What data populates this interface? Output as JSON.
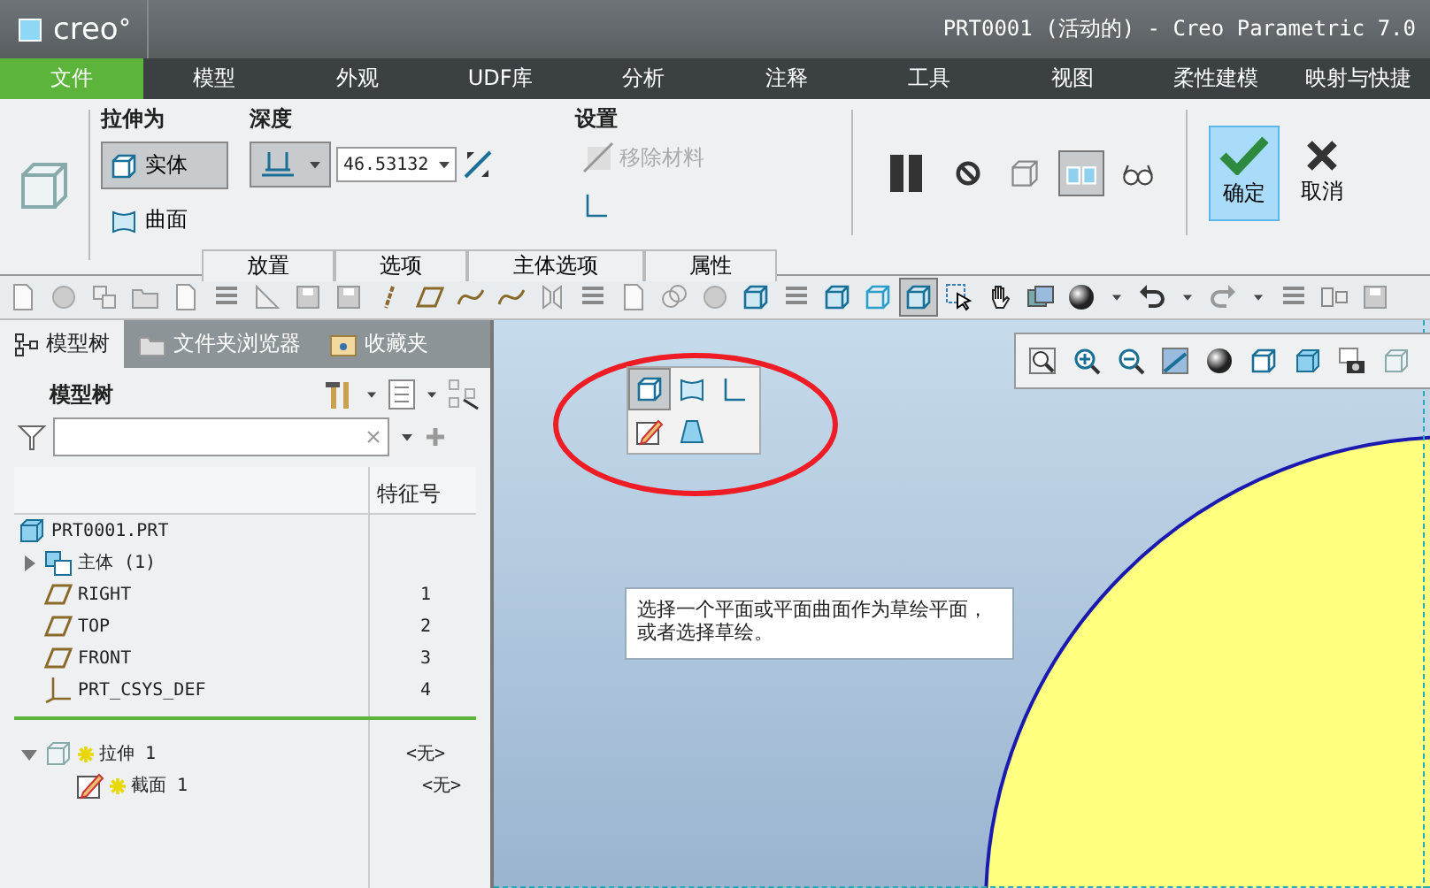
{
  "title_bar": {
    "app_name": "creo",
    "title": "PRT0001 (活动的) - Creo Parametric 7.0"
  },
  "menu_tabs": [
    {
      "label": "文件",
      "selected": true
    },
    {
      "label": "模型",
      "selected": false
    },
    {
      "label": "外观",
      "selected": false
    },
    {
      "label": "UDF库",
      "selected": false
    },
    {
      "label": "分析",
      "selected": false
    },
    {
      "label": "注释",
      "selected": false
    },
    {
      "label": "工具",
      "selected": false
    },
    {
      "label": "视图",
      "selected": false
    },
    {
      "label": "柔性建模",
      "selected": false
    },
    {
      "label": "映射与快捷",
      "selected": false
    }
  ],
  "ribbon": {
    "extrude_as": {
      "title": "拉伸为",
      "options": [
        {
          "label": "实体",
          "kind": "solid",
          "selected": true
        },
        {
          "label": "曲面",
          "kind": "surface",
          "selected": false
        }
      ]
    },
    "depth": {
      "title": "深度",
      "value": "46.53132"
    },
    "settings": {
      "title": "设置",
      "remove_material": {
        "label": "移除材料",
        "disabled": true
      }
    },
    "panel_tabs": [
      "放置",
      "选项",
      "主体选项",
      "属性"
    ],
    "preview_tools": [
      {
        "kind": "pause",
        "selected": false
      },
      {
        "kind": "no_entry",
        "selected": false
      },
      {
        "kind": "wire_preview",
        "selected": false
      },
      {
        "kind": "verify",
        "selected": true
      },
      {
        "kind": "glasses",
        "selected": false
      }
    ],
    "ok": {
      "label": "确定",
      "selected": true
    },
    "cancel": {
      "label": "取消"
    }
  },
  "toolbar": [
    {
      "kind": "document",
      "selected": false
    },
    {
      "kind": "sphere",
      "selected": false
    },
    {
      "kind": "copy",
      "selected": false
    },
    {
      "kind": "folder",
      "selected": false
    },
    {
      "kind": "document",
      "selected": false
    },
    {
      "kind": "list",
      "selected": false
    },
    {
      "kind": "ruler",
      "selected": false
    },
    {
      "kind": "disk",
      "selected": false
    },
    {
      "kind": "disk",
      "selected": false
    },
    {
      "kind": "line",
      "selected": false
    },
    {
      "kind": "plane",
      "selected": false
    },
    {
      "kind": "curve",
      "selected": false
    },
    {
      "kind": "curve",
      "selected": false
    },
    {
      "kind": "mirror",
      "selected": false
    },
    {
      "kind": "list",
      "selected": false
    },
    {
      "kind": "document",
      "selected": false
    },
    {
      "kind": "circles",
      "selected": false
    },
    {
      "kind": "sphere",
      "selected": false
    },
    {
      "kind": "cube",
      "selected": false
    },
    {
      "kind": "list",
      "selected": false
    },
    {
      "kind": "cube",
      "selected": false
    },
    {
      "kind": "wire_cube",
      "selected": false
    },
    {
      "kind": "cube",
      "selected": true
    },
    {
      "kind": "cursor",
      "selected": false
    },
    {
      "kind": "hand",
      "selected": false
    },
    {
      "kind": "images",
      "selected": false
    },
    {
      "kind": "ball",
      "selected": false
    },
    {
      "kind": "caret",
      "selected": false
    },
    {
      "kind": "undo",
      "selected": false
    },
    {
      "kind": "caret",
      "selected": false
    },
    {
      "kind": "redo",
      "selected": false
    },
    {
      "kind": "caret",
      "selected": false
    },
    {
      "kind": "list",
      "selected": false
    },
    {
      "kind": "layout",
      "selected": false
    },
    {
      "kind": "disk",
      "selected": false
    }
  ],
  "navigator": {
    "tabs": [
      {
        "label": "模型树",
        "kind": "tree",
        "selected": true
      },
      {
        "label": "文件夹浏览器",
        "kind": "folders",
        "selected": false
      },
      {
        "label": "收藏夹",
        "kind": "favorites",
        "selected": false
      }
    ],
    "title": "模型树",
    "column_header": "特征号",
    "tree": [
      {
        "label": "PRT0001.PRT",
        "kind": "part",
        "children": [
          {
            "label": "主体 (1)",
            "kind": "bodies",
            "expanded": false
          },
          {
            "label": "RIGHT",
            "kind": "plane",
            "number": "1"
          },
          {
            "label": "TOP",
            "kind": "plane",
            "number": "2"
          },
          {
            "label": "FRONT",
            "kind": "plane",
            "number": "3"
          },
          {
            "label": "PRT_CSYS_DEF",
            "kind": "csys",
            "number": "4"
          },
          {
            "kind": "insert_marker"
          },
          {
            "label": "拉伸 1",
            "kind": "extrude",
            "new": true,
            "number": "<无>",
            "expanded": true,
            "children": [
              {
                "label": "截面 1",
                "kind": "sketch",
                "new": true,
                "number": "<无>"
              }
            ]
          }
        ]
      }
    ]
  },
  "graphics": {
    "mini_toolbar": [
      {
        "kind": "solid",
        "selected": true
      },
      {
        "kind": "surface",
        "selected": false
      },
      {
        "kind": "thicken",
        "selected": false
      },
      {
        "kind": "sketch",
        "selected": false
      },
      {
        "kind": "taper",
        "selected": false
      }
    ],
    "message": "选择一个平面或平面曲面作为草绘平面，或者选择草绘。"
  }
}
